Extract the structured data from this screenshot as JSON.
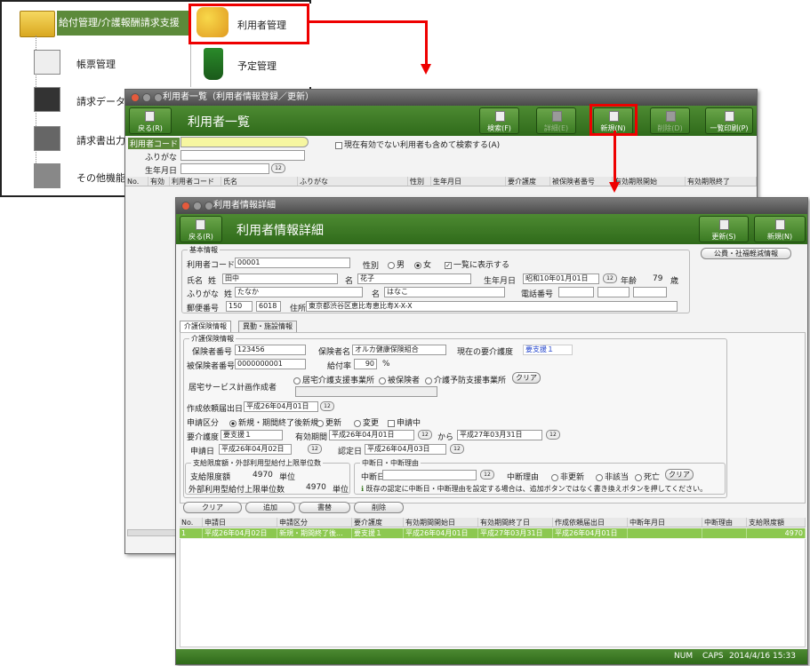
{
  "menu": {
    "header": "給付管理/介護報酬請求支援",
    "items": [
      "帳票管理",
      "請求データ",
      "請求書出力",
      "その他機能"
    ],
    "popup": [
      "利用者管理",
      "予定管理"
    ]
  },
  "listwin": {
    "title": "利用者一覧（利用者情報登録／更新）",
    "heading": "利用者一覧",
    "buttons": {
      "back": "戻る(R)",
      "search": "検索(F)",
      "detail": "詳細(E)",
      "new": "新規(N)",
      "delete": "削除(D)",
      "print": "一覧印刷(P)"
    },
    "fields": {
      "code": "利用者コード",
      "kana": "ふりがな",
      "birth": "生年月日",
      "inactive": "現在有効でない利用者も含めて検索する(A)"
    },
    "columns": [
      "No.",
      "有効",
      "利用者コード",
      "氏名",
      "ふりがな",
      "性別",
      "生年月日",
      "要介護度",
      "被保険者番号",
      "有効期限開始",
      "有効期限終了"
    ]
  },
  "detail": {
    "title": "利用者情報詳細",
    "heading": "利用者情報詳細",
    "buttons": {
      "back": "戻る(R)",
      "update": "更新(S)",
      "new": "新規(N)",
      "public": "公費・社福軽減情報"
    },
    "basic": {
      "group": "基本情報",
      "code_l": "利用者コード",
      "code": "00001",
      "sex_l": "性別",
      "male": "男",
      "female": "女",
      "list_show": "一覧に表示する",
      "name_l": "氏名",
      "sei_l": "姓",
      "sei": "田中",
      "mei_l": "名",
      "mei": "花子",
      "birth_l": "生年月日",
      "birth": "昭和10年01月01日",
      "age_l": "年齢",
      "age": "79",
      "age_u": "歳",
      "kana_l": "ふりがな",
      "ksei": "たなか",
      "kmei": "はなこ",
      "tel_l": "電話番号",
      "zip_l": "郵便番号",
      "zip1": "150",
      "zip2": "6018",
      "addr_l": "住所",
      "addr": "東京都渋谷区恵比寿恵比寿X-X-X"
    },
    "tabs": [
      "介護保険情報",
      "異動・施設情報"
    ],
    "ins": {
      "group": "介護保険情報",
      "insurer_no_l": "保険者番号",
      "insurer_no": "123456",
      "insurer_l": "保険者名",
      "insurer": "オルカ健康保険組合",
      "cur_l": "現在の要介護度",
      "cur": "要支援１",
      "insured_l": "被保険者番号",
      "insured": "0000000001",
      "rate_l": "給付率",
      "rate": "90",
      "rate_u": "%",
      "plan_l": "居宅サービス計画作成者",
      "plan_opts": [
        "居宅介護支援事業所",
        "被保険者",
        "介護予防支援事業所"
      ],
      "clear": "クリア",
      "req_date_l": "作成依頼届出日",
      "req_date": "平成26年04月01日",
      "app_l": "申請区分",
      "app_opts": [
        "新規・期間終了後新規",
        "更新",
        "変更"
      ],
      "app_chk": "申請中",
      "care_l": "要介護度",
      "care": "要支援１",
      "valid_l": "有効期間",
      "valid_from": "平成26年04月01日",
      "to": "から",
      "valid_to": "平成27年03月31日",
      "apply_l": "申請日",
      "apply": "平成26年04月02日",
      "cert_l": "認定日",
      "cert": "平成26年04月03日",
      "limit_group": "支給限度額・外部利用型給付上限単位数",
      "limit_l": "支給限度額",
      "limit": "4970",
      "unit": "単位",
      "ext_l": "外部利用型給付上限単位数",
      "ext": "4970",
      "stop_group": "中断日・中断理由",
      "stop_l": "中断日",
      "reason_l": "中断理由",
      "reason_opts": [
        "非更新",
        "非該当",
        "死亡"
      ],
      "note": "既存の認定に中断日・中断理由を設定する場合は、追加ボタンではなく書き換えボタンを押してください。"
    },
    "actions": [
      "クリア",
      "追加",
      "書替",
      "削除"
    ],
    "columns": [
      "No.",
      "申請日",
      "申請区分",
      "要介護度",
      "有効期間開始日",
      "有効期間終了日",
      "作成依頼届出日",
      "中断年月日",
      "中断理由",
      "支給限度額"
    ],
    "rows": [
      [
        "1",
        "平成26年04月02日",
        "新規・期間終了後...",
        "要支援１",
        "平成26年04月01日",
        "平成27年03月31日",
        "平成26年04月01日",
        "",
        "",
        "4970"
      ]
    ],
    "status": {
      "num": "NUM",
      "caps": "CAPS",
      "time": "2014/4/16 15:33"
    }
  }
}
